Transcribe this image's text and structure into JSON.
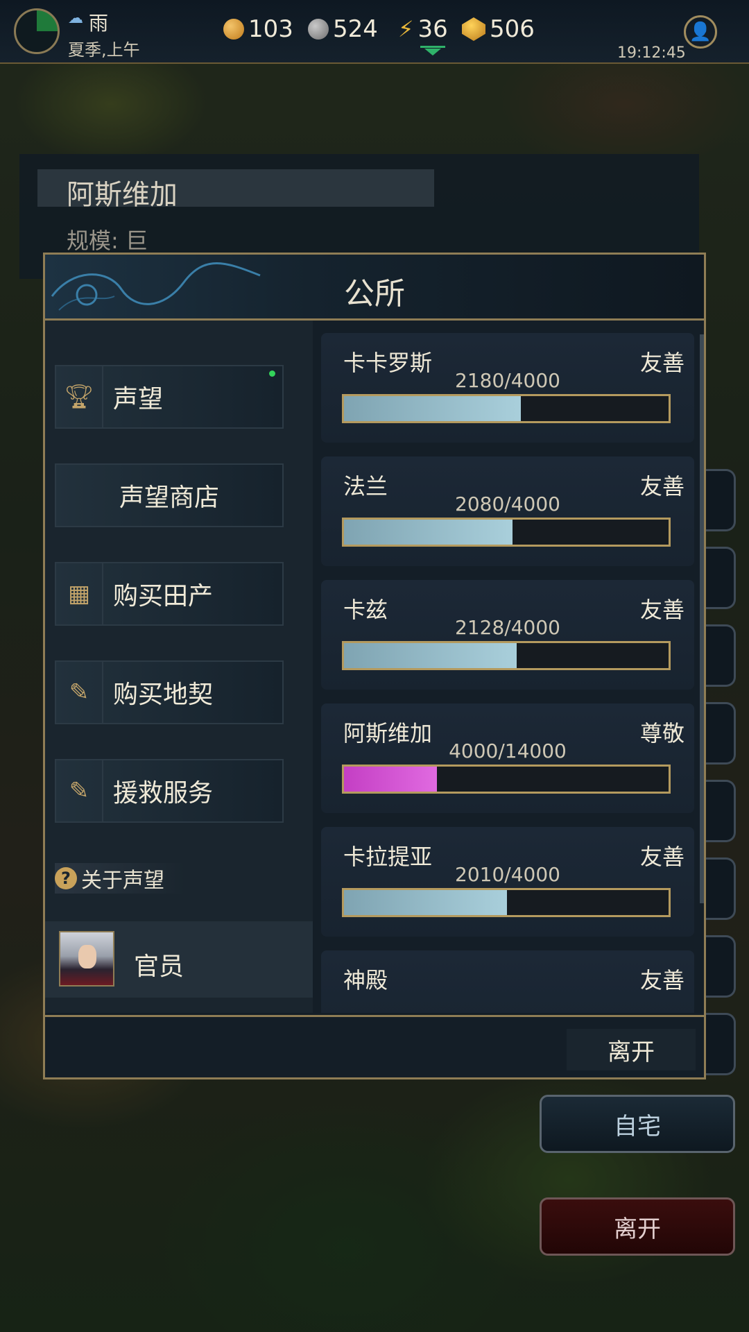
{
  "topbar": {
    "weather": "雨",
    "season": "夏季,上午",
    "gold": "103",
    "silver": "524",
    "energy": "36",
    "gems": "506",
    "time": "19:12:45"
  },
  "city": {
    "name": "阿斯维加",
    "scale": "规模: 巨"
  },
  "dialog": {
    "title": "公所",
    "menu": [
      {
        "label": "声望",
        "icon": "trophy-icon"
      },
      {
        "label": "声望商店"
      },
      {
        "label": "购买田产",
        "icon": "field-icon"
      },
      {
        "label": "购买地契",
        "icon": "deed-icon"
      },
      {
        "label": "援救服务",
        "icon": "deed-icon"
      }
    ],
    "about_label": "关于声望",
    "official_label": "官员",
    "leave_label": "离开"
  },
  "factions": [
    {
      "name": "卡卡罗斯",
      "status": "友善",
      "value": "2180/4000",
      "progress": 0.545,
      "color": "#a9cfdb"
    },
    {
      "name": "法兰",
      "status": "友善",
      "value": "2080/4000",
      "progress": 0.52,
      "color": "#a9cfdb"
    },
    {
      "name": "卡兹",
      "status": "友善",
      "value": "2128/4000",
      "progress": 0.532,
      "color": "#a9cfdb"
    },
    {
      "name": "阿斯维加",
      "status": "尊敬",
      "value": "4000/14000",
      "progress": 0.2857,
      "color": "#e06ae0"
    },
    {
      "name": "卡拉提亚",
      "status": "友善",
      "value": "2010/4000",
      "progress": 0.5025,
      "color": "#a9cfdb"
    },
    {
      "name": "神殿",
      "status": "友善"
    }
  ],
  "side_buttons": {
    "home": "自宅",
    "leave": "离开"
  }
}
